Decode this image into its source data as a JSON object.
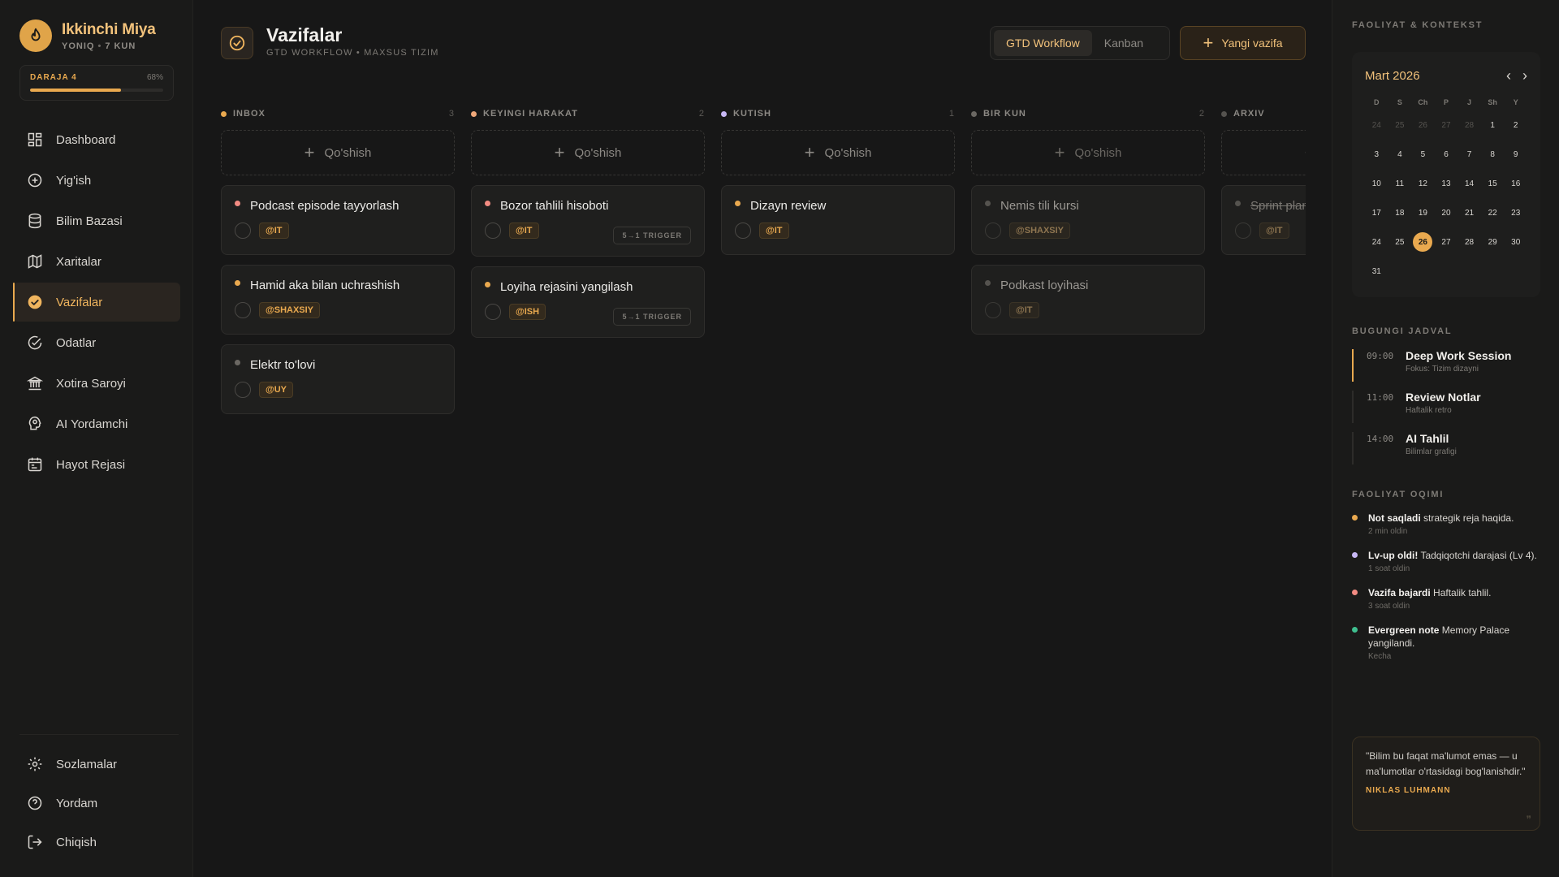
{
  "brand": {
    "name": "Ikkinchi Miya",
    "status": "YONIQ",
    "streak": "7 KUN"
  },
  "level": {
    "label": "DARAJA 4",
    "percent_text": "68%",
    "progress": 0.68
  },
  "nav": {
    "items": [
      {
        "label": "Dashboard",
        "icon": "dashboard-icon"
      },
      {
        "label": "Yig'ish",
        "icon": "plus-circle-icon"
      },
      {
        "label": "Bilim Bazasi",
        "icon": "database-icon"
      },
      {
        "label": "Xaritalar",
        "icon": "map-icon"
      },
      {
        "label": "Vazifalar",
        "icon": "check-circle-icon",
        "active": true
      },
      {
        "label": "Odatlar",
        "icon": "badge-check-icon"
      },
      {
        "label": "Xotira Saroyi",
        "icon": "landmark-icon"
      },
      {
        "label": "AI Yordamchi",
        "icon": "brain-icon"
      },
      {
        "label": "Hayot Rejasi",
        "icon": "calendar-icon"
      }
    ],
    "bottom": [
      {
        "label": "Sozlamalar",
        "icon": "gear-icon"
      },
      {
        "label": "Yordam",
        "icon": "help-icon"
      },
      {
        "label": "Chiqish",
        "icon": "logout-icon"
      }
    ]
  },
  "header": {
    "title": "Vazifalar",
    "subtitle": "GTD WORKFLOW • MAXSUS TIZIM",
    "view_tabs": [
      "GTD Workflow",
      "Kanban"
    ],
    "new_task_label": "Yangi vazifa"
  },
  "board": {
    "add_label": "Qo'shish",
    "columns": [
      {
        "name": "INBOX",
        "count": "3",
        "color": "#e9a94f",
        "cards": [
          {
            "title": "Podcast episode tayyorlash",
            "tag": "@IT",
            "priority_color": "#f28b82"
          },
          {
            "title": "Hamid aka bilan uchrashish",
            "tag": "@SHAXSIY",
            "priority_color": "#e9a94f"
          },
          {
            "title": "Elektr to'lovi",
            "tag": "@UY",
            "priority_color": "#6b6863"
          }
        ]
      },
      {
        "name": "KEYINGI HARAKAT",
        "count": "2",
        "color": "#f0a87a",
        "cards": [
          {
            "title": "Bozor tahlili hisoboti",
            "tag": "@IT",
            "trigger": "5→1 TRIGGER",
            "priority_color": "#f28b82"
          },
          {
            "title": "Loyiha rejasini yangilash",
            "tag": "@ISH",
            "trigger": "5→1 TRIGGER",
            "priority_color": "#e9a94f"
          }
        ]
      },
      {
        "name": "KUTISH",
        "count": "1",
        "color": "#c8b8f5",
        "cards": [
          {
            "title": "Dizayn review",
            "tag": "@IT",
            "priority_color": "#e9a94f"
          }
        ]
      },
      {
        "name": "BIR KUN",
        "count": "2",
        "color": "#6b6863",
        "cards": [
          {
            "title": "Nemis tili kursi",
            "tag": "@SHAXSIY",
            "priority_color": "#55534f"
          },
          {
            "title": "Podkast loyihasi",
            "tag": "@IT",
            "priority_color": "#55534f"
          }
        ]
      },
      {
        "name": "ARXIV",
        "count": "",
        "color": "#55534f",
        "cards": [
          {
            "title": "Sprint plan",
            "tag": "@IT",
            "priority_color": "#55534f"
          }
        ]
      }
    ]
  },
  "right_panel": {
    "section_title": "FAOLIYAT & KONTEKST",
    "calendar": {
      "month": "Mart 2026",
      "weekdays": [
        "D",
        "S",
        "Ch",
        "P",
        "J",
        "Sh",
        "Y"
      ],
      "days": [
        [
          "24",
          "25",
          "26",
          "27",
          "28",
          "1",
          "2"
        ],
        [
          "3",
          "4",
          "5",
          "6",
          "7",
          "8",
          "9"
        ],
        [
          "10",
          "11",
          "12",
          "13",
          "14",
          "15",
          "16"
        ],
        [
          "17",
          "18",
          "19",
          "20",
          "21",
          "22",
          "23"
        ],
        [
          "24",
          "25",
          "26",
          "27",
          "28",
          "29",
          "30"
        ],
        [
          "31",
          "",
          "",
          "",
          "",
          "",
          ""
        ]
      ],
      "today": "26"
    },
    "schedule_title": "BUGUNGI JADVAL",
    "schedule": [
      {
        "time": "09:00",
        "title": "Deep Work Session",
        "desc": "Fokus: Tizim dizayni",
        "active": true
      },
      {
        "time": "11:00",
        "title": "Review Notlar",
        "desc": "Haftalik retro"
      },
      {
        "time": "14:00",
        "title": "AI Tahlil",
        "desc": "Bilimlar grafigi"
      }
    ],
    "activity_title": "FAOLIYAT OQIMI",
    "activity": [
      {
        "bold": "Not saqladi",
        "text": " strategik reja haqida.",
        "time": "2 min oldin",
        "color": "#e9a94f"
      },
      {
        "bold": "Lv-up oldi!",
        "text": " Tadqiqotchi darajasi (Lv 4).",
        "time": "1 soat oldin",
        "color": "#c8b8f5"
      },
      {
        "bold": "Vazifa bajardi",
        "text": " Haftalik tahlil.",
        "time": "3 soat oldin",
        "color": "#f28b82"
      },
      {
        "bold": "Evergreen note",
        "text": " Memory Palace yangilandi.",
        "time": "Kecha",
        "color": "#3fbf8f"
      }
    ],
    "quote": {
      "text": "\"Bilim bu faqat ma'lumot emas — u ma'lumotlar o'rtasidagi bog'lanishdir.\"",
      "author": "NIKLAS LUHMANN"
    }
  }
}
